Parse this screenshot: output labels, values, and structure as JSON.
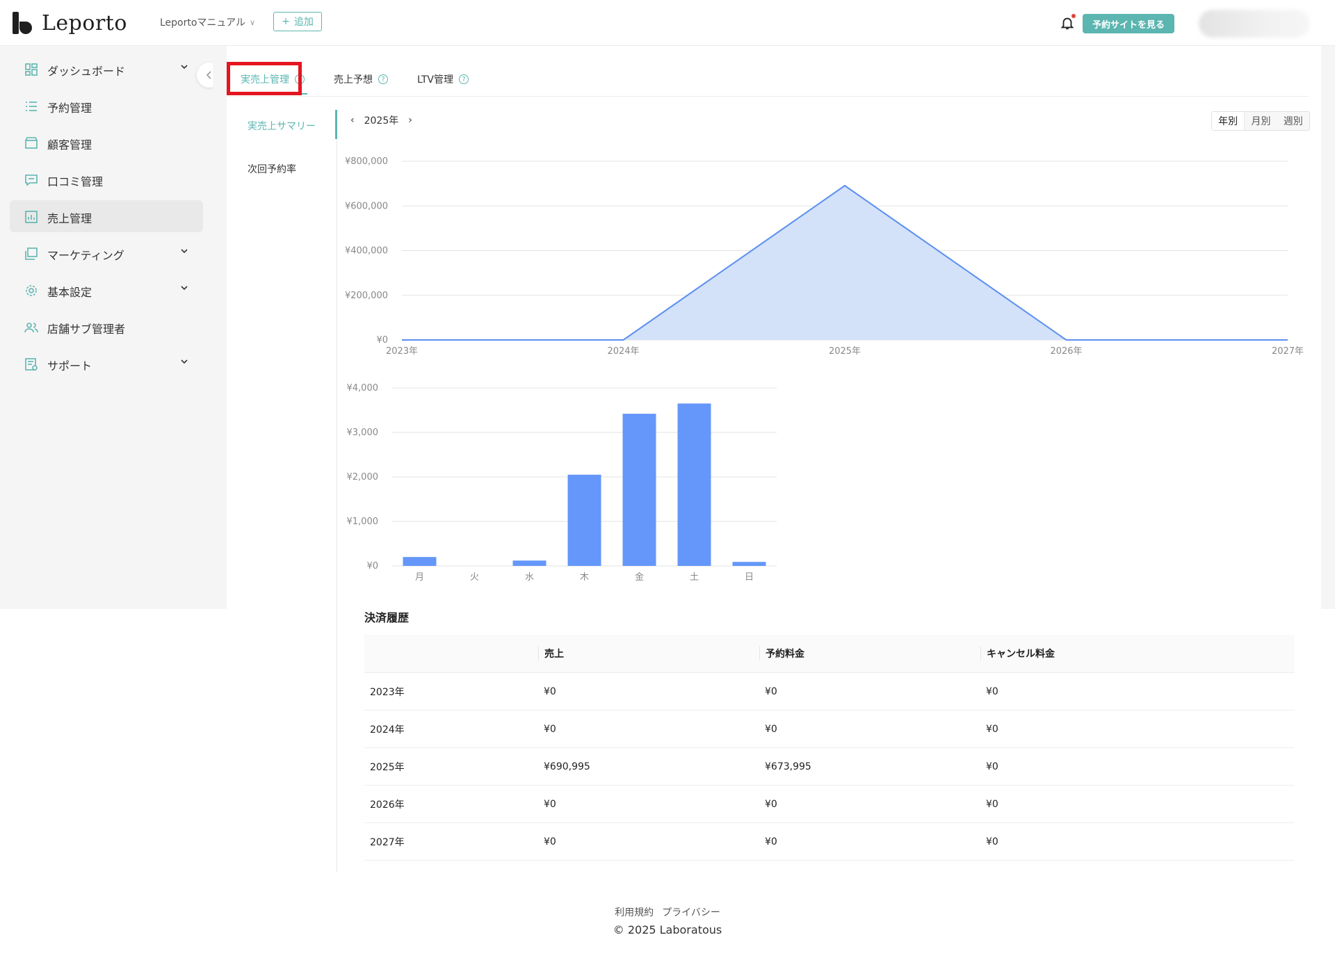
{
  "header": {
    "logo_text": "Leporto",
    "store_name": "Leportoマニュアル",
    "add_label": "追加",
    "site_button": "予約サイトを見る"
  },
  "sidebar": {
    "items": [
      {
        "label": "ダッシュボード",
        "icon": "dashboard-icon",
        "has_chevron": true
      },
      {
        "label": "予約管理",
        "icon": "list-icon",
        "has_chevron": false
      },
      {
        "label": "顧客管理",
        "icon": "customer-icon",
        "has_chevron": false
      },
      {
        "label": "口コミ管理",
        "icon": "comment-icon",
        "has_chevron": false
      },
      {
        "label": "売上管理",
        "icon": "chart-icon",
        "has_chevron": false,
        "active": true
      },
      {
        "label": "マーケティング",
        "icon": "marketing-icon",
        "has_chevron": true
      },
      {
        "label": "基本設定",
        "icon": "gear-icon",
        "has_chevron": true
      },
      {
        "label": "店舗サブ管理者",
        "icon": "users-icon",
        "has_chevron": false
      },
      {
        "label": "サポート",
        "icon": "support-icon",
        "has_chevron": true
      }
    ]
  },
  "tabs": [
    {
      "label": "実売上管理",
      "active": true
    },
    {
      "label": "売上予想",
      "active": false
    },
    {
      "label": "LTV管理",
      "active": false
    }
  ],
  "subnav": [
    {
      "label": "実売上サマリー",
      "active": true
    },
    {
      "label": "次回予約率",
      "active": false
    }
  ],
  "period": {
    "year_label": "2025年",
    "segments": [
      "年別",
      "月別",
      "週別"
    ],
    "selected": "年別"
  },
  "chart_data": [
    {
      "type": "area",
      "x": [
        "2023年",
        "2024年",
        "2025年",
        "2026年",
        "2027年"
      ],
      "values": [
        0,
        0,
        690995,
        0,
        0
      ],
      "yticks": [
        "¥800,000",
        "¥600,000",
        "¥400,000",
        "¥200,000",
        "¥0"
      ],
      "ylim": [
        0,
        800000
      ],
      "grid": true,
      "colors": {
        "line": "#5b8ff0",
        "fill": "#d3e1f9"
      }
    },
    {
      "type": "bar",
      "categories": [
        "月",
        "火",
        "水",
        "木",
        "金",
        "土",
        "日"
      ],
      "values": [
        200,
        0,
        120,
        2050,
        3420,
        3650,
        90
      ],
      "yticks": [
        "¥4,000",
        "¥3,000",
        "¥2,000",
        "¥1,000",
        "¥0"
      ],
      "ylim": [
        0,
        4000
      ],
      "grid": true,
      "colors": {
        "bar": "#6497f9"
      }
    }
  ],
  "history": {
    "title": "決済履歴",
    "columns": [
      "",
      "売上",
      "予約料金",
      "キャンセル料金"
    ],
    "rows": [
      [
        "2023年",
        "¥0",
        "¥0",
        "¥0"
      ],
      [
        "2024年",
        "¥0",
        "¥0",
        "¥0"
      ],
      [
        "2025年",
        "¥690,995",
        "¥673,995",
        "¥0"
      ],
      [
        "2026年",
        "¥0",
        "¥0",
        "¥0"
      ],
      [
        "2027年",
        "¥0",
        "¥0",
        "¥0"
      ]
    ]
  },
  "footer": {
    "terms": "利用規約",
    "privacy": "プライバシー",
    "copyright": "© 2025 Laboratous"
  },
  "colors": {
    "accent": "#5bb5b0",
    "highlight_box": "#e4151f"
  }
}
